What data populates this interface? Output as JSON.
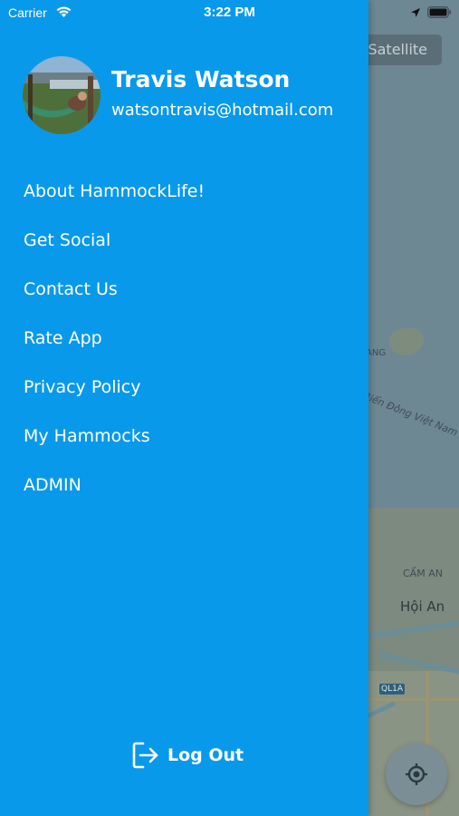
{
  "status_bar": {
    "carrier": "Carrier",
    "time": "3:22 PM"
  },
  "map": {
    "satellite_label": "Satellite",
    "labels": {
      "sea": "Biển Đông Việt Nam",
      "cam_an": "CẨM AN",
      "hoi_an": "Hội An",
      "ang": "ANG",
      "road": "QL1A"
    }
  },
  "drawer": {
    "user": {
      "name": "Travis Watson",
      "email": "watsontravis@hotmail.com"
    },
    "menu": [
      {
        "label": "About HammockLife!"
      },
      {
        "label": "Get Social"
      },
      {
        "label": "Contact Us"
      },
      {
        "label": "Rate App"
      },
      {
        "label": "Privacy Policy"
      },
      {
        "label": "My Hammocks"
      },
      {
        "label": "ADMIN"
      }
    ],
    "logout_label": "Log Out"
  },
  "colors": {
    "drawer_background": "#0999ea",
    "text": "#ffffff",
    "map_water": "#6d8793"
  },
  "icons": [
    "wifi-icon",
    "location-arrow-icon",
    "battery-icon",
    "logout-icon",
    "locate-icon"
  ]
}
